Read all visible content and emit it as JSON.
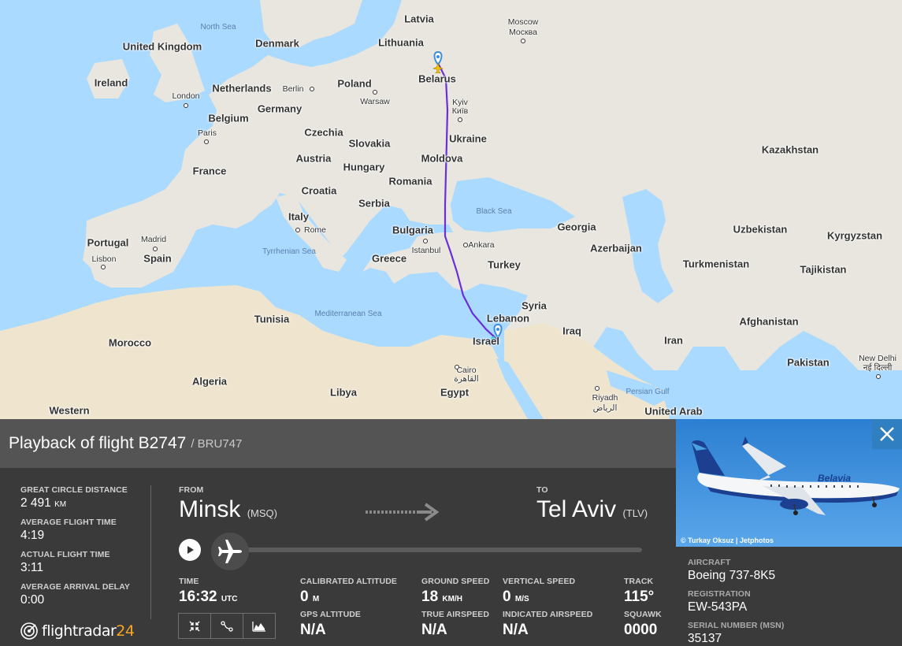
{
  "map": {
    "countries": [
      "Latvia",
      "Lithuania",
      "Belarus",
      "Denmark",
      "United Kingdom",
      "Ireland",
      "Netherlands",
      "Poland",
      "Germany",
      "Belgium",
      "Czechia",
      "Slovakia",
      "Ukraine",
      "France",
      "Austria",
      "Hungary",
      "Moldova",
      "Croatia",
      "Romania",
      "Serbia",
      "Italy",
      "Bulgaria",
      "Portugal",
      "Spain",
      "Greece",
      "Turkey",
      "Georgia",
      "Azerbaijan",
      "Kazakhstan",
      "Uzbekistan",
      "Kyrgyzstan",
      "Turkmenistan",
      "Tajikistan",
      "Syria",
      "Lebanon",
      "Iraq",
      "Iran",
      "Afghanistan",
      "Israel",
      "Pakistan",
      "Tunisia",
      "Morocco",
      "Algeria",
      "Libya",
      "Egypt",
      "Western",
      "United Arab"
    ],
    "cities": [
      "Moscow",
      "Москва",
      "Berlin",
      "Warsaw",
      "London",
      "Paris",
      "Kyiv",
      "Київ",
      "Rome",
      "Madrid",
      "Lisbon",
      "Istanbul",
      "Ankara",
      "Cairo",
      "القاهرة",
      "Riyadh",
      "الرياض",
      "New Delhi",
      "नई दिल्ली"
    ],
    "seas": [
      "North Sea",
      "Black Sea",
      "Tyrrhenian Sea",
      "Mediterranean Sea",
      "Persian Gulf"
    ]
  },
  "flight": {
    "title": "Playback of flight B2747",
    "callsign": "/ BRU747"
  },
  "stats": {
    "great_circle_label": "GREAT CIRCLE DISTANCE",
    "great_circle_value": "2 491",
    "great_circle_unit": "KM",
    "avg_time_label": "AVERAGE FLIGHT TIME",
    "avg_time_value": "4:19",
    "actual_time_label": "ACTUAL FLIGHT TIME",
    "actual_time_value": "3:11",
    "avg_delay_label": "AVERAGE ARRIVAL DELAY",
    "avg_delay_value": "0:00"
  },
  "route": {
    "from_label": "FROM",
    "from_city": "Minsk",
    "from_code": "(MSQ)",
    "to_label": "TO",
    "to_city": "Tel Aviv",
    "to_code": "(TLV)"
  },
  "playback": {
    "progress": 0
  },
  "metrics": {
    "time_label": "TIME",
    "time_value": "16:32",
    "time_unit": "UTC",
    "cal_alt_label": "CALIBRATED ALTITUDE",
    "cal_alt_value": "0",
    "cal_alt_unit": "M",
    "gps_alt_label": "GPS ALTITUDE",
    "gps_alt_value": "N/A",
    "ground_speed_label": "GROUND SPEED",
    "ground_speed_value": "18",
    "ground_speed_unit": "KM/H",
    "true_airspeed_label": "TRUE AIRSPEED",
    "true_airspeed_value": "N/A",
    "vertical_speed_label": "VERTICAL SPEED",
    "vertical_speed_value": "0",
    "vertical_speed_unit": "M/S",
    "indicated_airspeed_label": "INDICATED AIRSPEED",
    "indicated_airspeed_value": "N/A",
    "track_label": "TRACK",
    "track_value": "115°",
    "squawk_label": "SQUAWK",
    "squawk_value": "0000"
  },
  "logo": {
    "text_main": "flightradar",
    "text_accent": "24",
    "accent_color": "#f6a623"
  },
  "aircraft": {
    "photo_credit": "© Turkay Oksuz | Jetphotos",
    "livery_text": "Belavia",
    "aircraft_label": "AIRCRAFT",
    "aircraft_value": "Boeing 737-8K5",
    "registration_label": "REGISTRATION",
    "registration_value": "EW-543PA",
    "serial_label": "SERIAL NUMBER (MSN)",
    "serial_value": "35137"
  },
  "colors": {
    "track": "#6a2fd6",
    "water": "#aadaff",
    "land": "#e8e6df",
    "close_button": "#2f7fc1"
  },
  "icons": {
    "origin_marker": "map-pin-icon",
    "destination_marker": "map-pin-icon",
    "play": "play-icon",
    "aircraft": "airplane-icon",
    "close": "close-icon",
    "tool_1": "fit-view-icon",
    "tool_2": "route-icon",
    "tool_3": "altitude-chart-icon"
  }
}
